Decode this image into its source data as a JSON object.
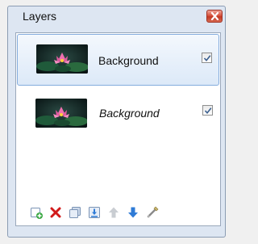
{
  "window": {
    "title": "Layers"
  },
  "layers": [
    {
      "name": "Background",
      "visible": true,
      "selected": true,
      "italic": false
    },
    {
      "name": "Background",
      "visible": true,
      "selected": false,
      "italic": true
    }
  ],
  "toolbar": {
    "buttons": [
      {
        "icon": "add-layer-icon",
        "enabled": true
      },
      {
        "icon": "delete-layer-icon",
        "enabled": true
      },
      {
        "icon": "duplicate-layer-icon",
        "enabled": true
      },
      {
        "icon": "merge-layer-down-icon",
        "enabled": true
      },
      {
        "icon": "move-layer-up-icon",
        "enabled": false
      },
      {
        "icon": "move-layer-down-icon",
        "enabled": true
      },
      {
        "icon": "layer-properties-icon",
        "enabled": true
      }
    ]
  },
  "colors": {
    "accent_selection": "#dce9f8",
    "close_button": "#c23a25"
  }
}
